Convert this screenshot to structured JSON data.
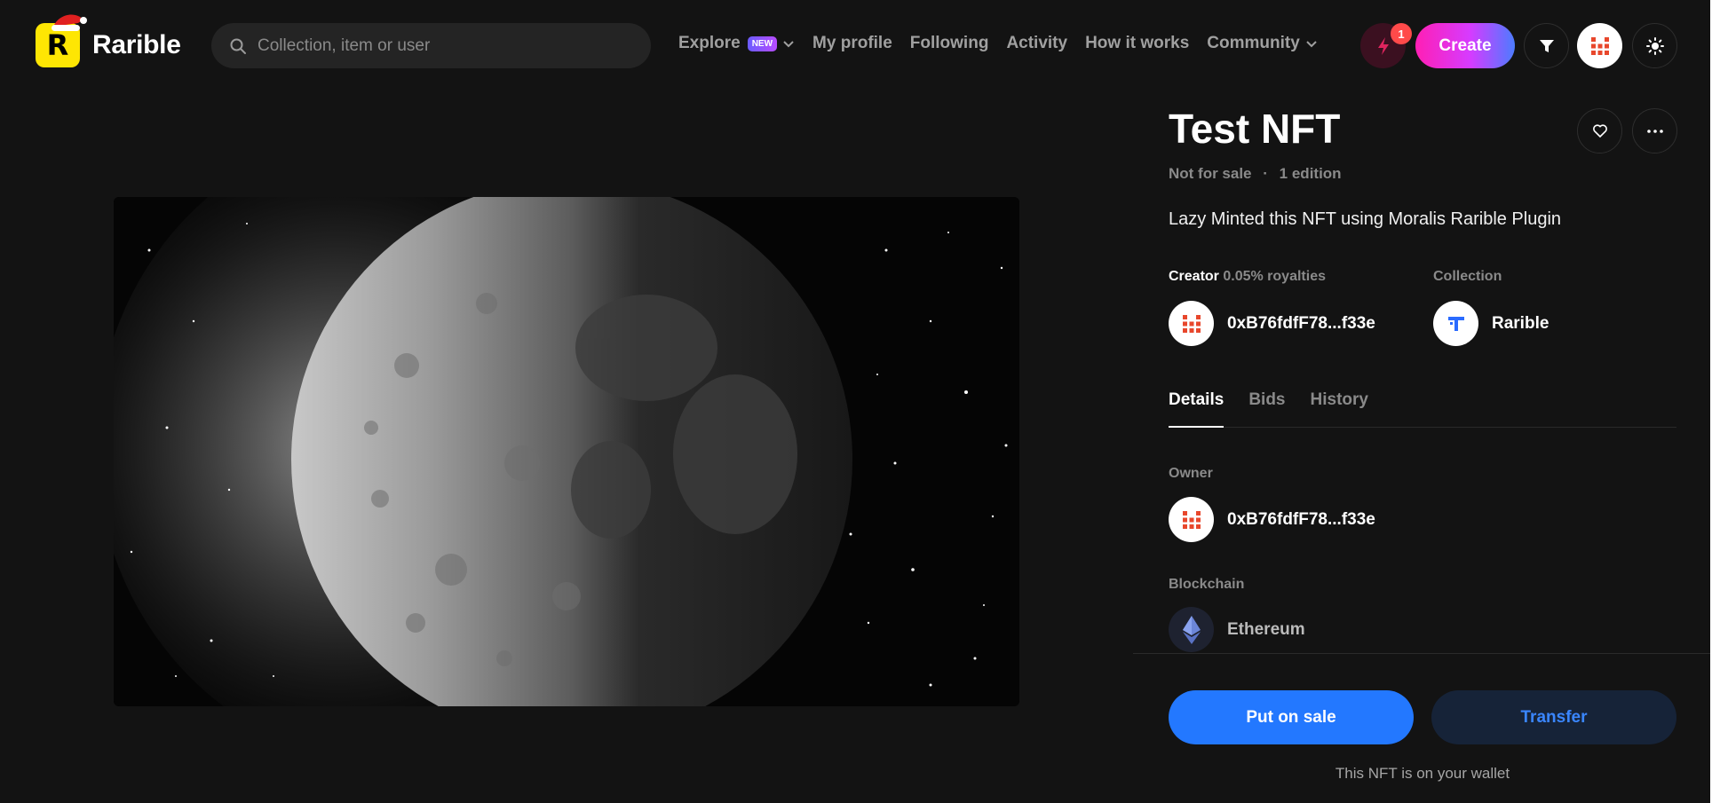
{
  "header": {
    "logo_text": "Rarible",
    "logo_mark": "R",
    "search_placeholder": "Collection, item or user",
    "nav": [
      {
        "label": "Explore",
        "badge": "NEW",
        "has_dropdown": true
      },
      {
        "label": "My profile"
      },
      {
        "label": "Following"
      },
      {
        "label": "Activity"
      },
      {
        "label": "How it works"
      },
      {
        "label": "Community",
        "has_dropdown": true
      }
    ],
    "notification_count": "1",
    "create_label": "Create",
    "icons": [
      "search-icon",
      "bolt-icon",
      "filter-icon",
      "avatar-grid-icon",
      "sun-icon"
    ]
  },
  "nft": {
    "title": "Test NFT",
    "sale_status": "Not for sale",
    "separator": "·",
    "editions": "1 edition",
    "description": "Lazy Minted this NFT using Moralis Rarible Plugin",
    "creator_label": "Creator",
    "royalties": "0.05% royalties",
    "creator_address": "0xB76fdfF78...f33e",
    "collection_label": "Collection",
    "collection_name": "Rarible"
  },
  "tabs": [
    "Details",
    "Bids",
    "History"
  ],
  "active_tab": "Details",
  "details": {
    "owner_label": "Owner",
    "owner_address": "0xB76fdfF78...f33e",
    "blockchain_label": "Blockchain",
    "blockchain_name": "Ethereum"
  },
  "actions": {
    "primary": "Put on sale",
    "secondary": "Transfer",
    "note": "This NFT is on your wallet"
  },
  "colors": {
    "background": "#131313",
    "logo_yellow": "#fee603",
    "primary_blue": "#2378ff",
    "create_gradient_start": "#ff1fb4",
    "avatar_red": "#e8472c"
  }
}
